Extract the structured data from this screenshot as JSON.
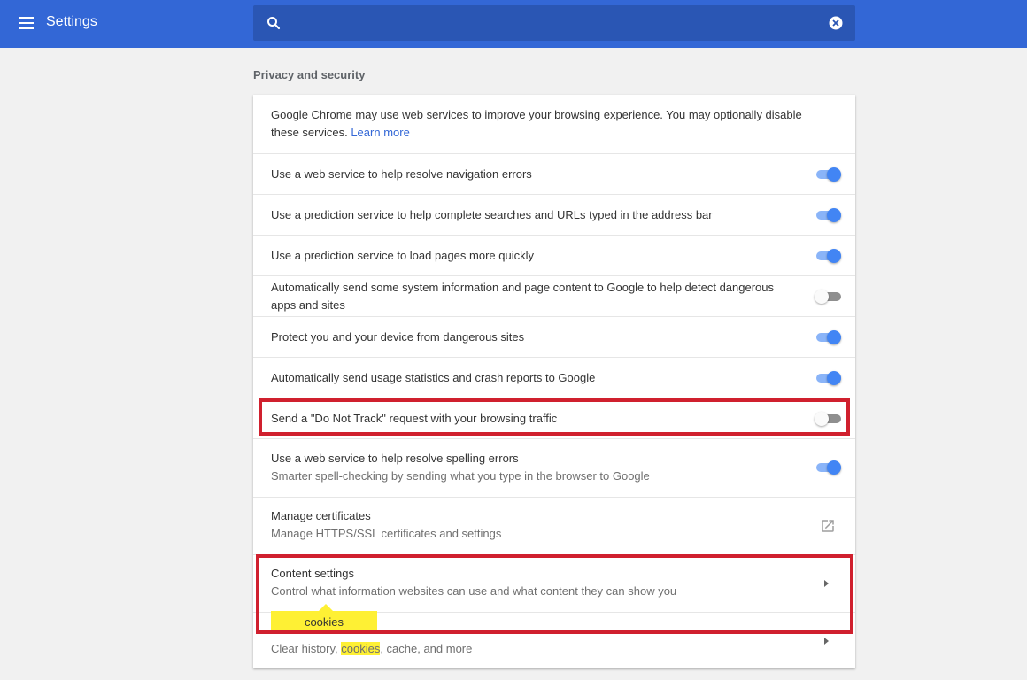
{
  "app": {
    "title": "Settings"
  },
  "search": {
    "value": "",
    "placeholder": ""
  },
  "section": {
    "title": "Privacy and security"
  },
  "intro": {
    "text": "Google Chrome may use web services to improve your browsing experience. You may optionally disable these services.",
    "link": "Learn more"
  },
  "settings": [
    {
      "label": "Use a web service to help resolve navigation errors",
      "state": "on"
    },
    {
      "label": "Use a prediction service to help complete searches and URLs typed in the address bar",
      "state": "on"
    },
    {
      "label": "Use a prediction service to load pages more quickly",
      "state": "on"
    },
    {
      "label": "Automatically send some system information and page content to Google to help detect dangerous apps and sites",
      "state": "off"
    },
    {
      "label": "Protect you and your device from dangerous sites",
      "state": "on"
    },
    {
      "label": "Automatically send usage statistics and crash reports to Google",
      "state": "on"
    },
    {
      "label": "Send a \"Do Not Track\" request with your browsing traffic",
      "state": "off"
    },
    {
      "label": "Use a web service to help resolve spelling errors",
      "sublabel": "Smarter spell-checking by sending what you type in the browser to Google",
      "state": "on"
    }
  ],
  "manage_certificates": {
    "label": "Manage certificates",
    "sublabel": "Manage HTTPS/SSL certificates and settings"
  },
  "content_settings": {
    "label": "Content settings",
    "sublabel": "Control what information websites can use and what content they can show you"
  },
  "clear_browsing": {
    "sublabel_before": "Clear history, ",
    "sublabel_match": "cookies",
    "sublabel_after": ", cache, and more"
  },
  "tooltip": {
    "text": "cookies"
  },
  "colors": {
    "header": "#3367d6",
    "search_bar": "#2a56b4",
    "toggle_on": "#4285f4",
    "highlight_box": "#d0202e",
    "search_highlight": "#fef034"
  }
}
